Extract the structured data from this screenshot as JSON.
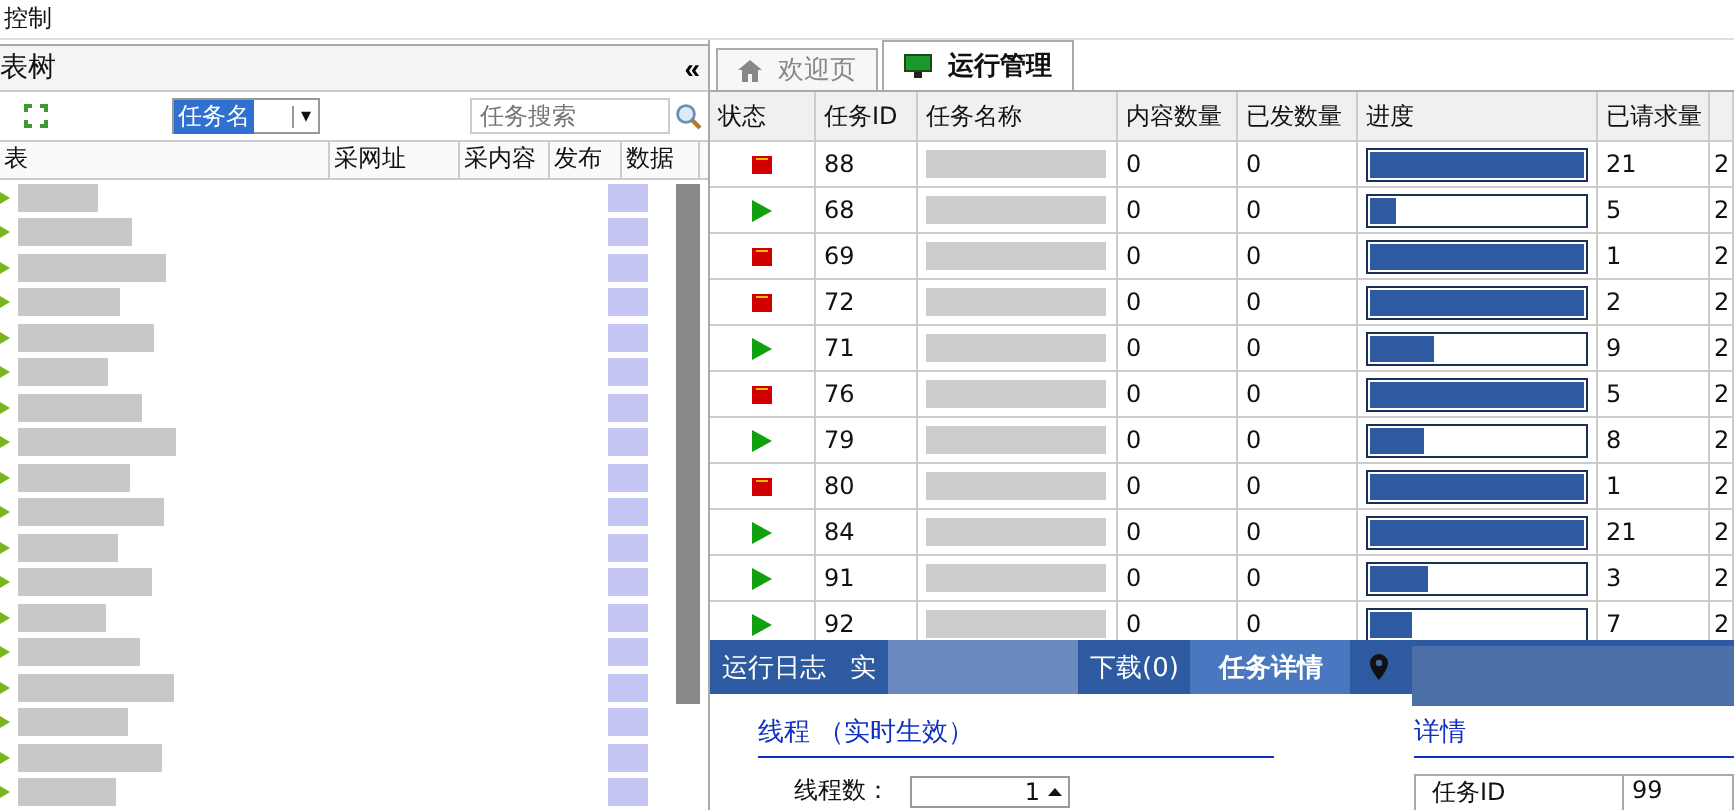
{
  "menu_bar": {
    "items": [
      "控制"
    ]
  },
  "left_panel": {
    "title": "表树",
    "collapse_button": "«",
    "filter": {
      "value": "任务名",
      "caret": "▾"
    },
    "search": {
      "placeholder": "任务搜索"
    },
    "columns": [
      "表",
      "采网址",
      "采内容",
      "发布",
      "数据"
    ]
  },
  "tabs": [
    {
      "label": "欢迎页",
      "selected": false,
      "kind": "home"
    },
    {
      "label": "运行管理",
      "selected": true,
      "kind": "monitor"
    }
  ],
  "table": {
    "columns": [
      "状态",
      "任务ID",
      "任务名称",
      "内容数量",
      "已发数量",
      "进度",
      "已请求量"
    ],
    "rows": [
      {
        "running": false,
        "id": "88",
        "content": "0",
        "sent": "0",
        "level": 1,
        "requested": "21",
        "column_8": "2"
      },
      {
        "running": true,
        "id": "68",
        "content": "0",
        "sent": "0",
        "level": 0.12,
        "requested": "5",
        "column_8": "2"
      },
      {
        "running": false,
        "id": "69",
        "content": "0",
        "sent": "0",
        "level": 1,
        "requested": "1",
        "column_8": "2"
      },
      {
        "running": false,
        "id": "72",
        "content": "0",
        "sent": "0",
        "level": 1,
        "requested": "2",
        "column_8": "2"
      },
      {
        "running": true,
        "id": "71",
        "content": "0",
        "sent": "0",
        "level": 0.3,
        "requested": "9",
        "column_8": "2"
      },
      {
        "running": false,
        "id": "76",
        "content": "0",
        "sent": "0",
        "level": 1,
        "requested": "5",
        "column_8": "2"
      },
      {
        "running": true,
        "id": "79",
        "content": "0",
        "sent": "0",
        "level": 0.25,
        "requested": "8",
        "column_8": "2"
      },
      {
        "running": false,
        "id": "80",
        "content": "0",
        "sent": "0",
        "level": 1,
        "requested": "1",
        "column_8": "2"
      },
      {
        "running": true,
        "id": "84",
        "content": "0",
        "sent": "0",
        "level": 1,
        "requested": "21",
        "column_8": "2"
      },
      {
        "running": true,
        "id": "91",
        "content": "0",
        "sent": "0",
        "level": 0.27,
        "requested": "3",
        "column_8": "2"
      },
      {
        "running": true,
        "id": "92",
        "content": "0",
        "sent": "0",
        "level": 0.2,
        "requested": "7",
        "column_8": "2"
      }
    ]
  },
  "bottom_tabs": [
    {
      "label": "运行日志",
      "selected": false
    },
    {
      "label": "实",
      "selected": false
    },
    {
      "label": "下载(0)",
      "selected": false
    },
    {
      "label": "任务详情",
      "selected": true
    }
  ],
  "thread_section": {
    "title": "线程 （实时生效）",
    "label": "线程数：",
    "value": "1"
  },
  "details": {
    "title": "详情",
    "rows": [
      {
        "key": "任务ID",
        "value": "99"
      }
    ]
  }
}
